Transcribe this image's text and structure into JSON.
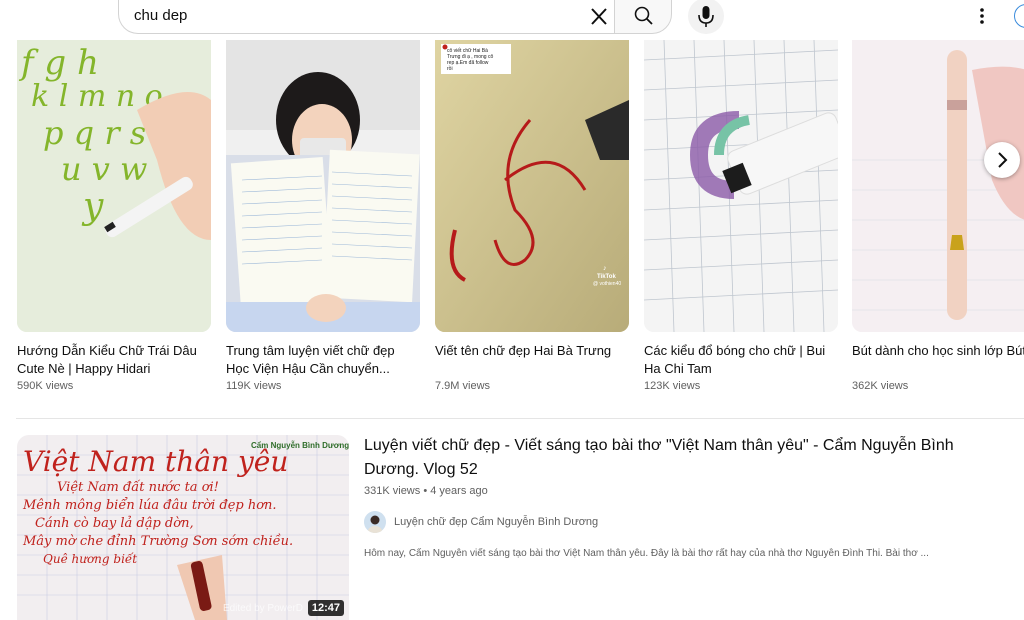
{
  "search": {
    "query": "chu dep"
  },
  "icons": {
    "clear": "close-icon",
    "search": "search-icon",
    "mic": "microphone-icon",
    "more": "more-vert-icon",
    "next": "chevron-right-icon"
  },
  "shorts": [
    {
      "title": "Hướng Dẫn Kiểu Chữ Trái Dâu Cute Nè | Happy Hidari",
      "views": "590K views"
    },
    {
      "title": "Trung tâm luyện viết chữ đẹp Học Viện Hậu Cần chuyển...",
      "views": "119K views"
    },
    {
      "title": "Viết tên chữ đẹp Hai Bà Trưng",
      "views": "7.9M views"
    },
    {
      "title": "Các kiểu đổ bóng cho chữ | Bui Ha Chi Tam",
      "views": "123K views"
    },
    {
      "title": "Bút dành cho học sinh lớp Bút luyện chữ đẹp | Bút mà",
      "views": "362K views"
    }
  ],
  "thumb_text": {
    "short1_letters": "fgh klmno pqrst uvw y",
    "short3_caption": "cô viết chữ Hai Bà Trưng đi ạ , mong cô rep ạ.Em đã follow rồi",
    "short3_tiktok": "TikTok",
    "short3_user": "@ vothien40",
    "video_line1": "Việt Nam thân yêu",
    "video_credit": "Cẩm Nguyễn Bình Dương",
    "video_line2": "Việt Nam đất nước ta ơi!",
    "video_line3": "Mênh mông biển lúa đâu trời đẹp hơn.",
    "video_line4": "Cánh cò bay lả dập dờn,",
    "video_line5": "Mây mờ che đỉnh Trường Sơn sớm chiều.",
    "video_line6": "Quê hương biết",
    "watermark": "Edited by PowerD"
  },
  "video": {
    "title": "Luyện viết chữ đẹp - Viết sáng tạo bài thơ \"Việt Nam thân yêu\" - Cẩm Nguyễn Bình Dương. Vlog 52",
    "views": "331K views",
    "age": "4 years ago",
    "channel": "Luyện chữ đẹp Cẩm Nguyễn Bình Dương",
    "description": "Hôm nay, Cẩm Nguyễn viết sáng tạo bài thơ Việt Nam thân yêu. Đây là bài thơ rất hay của nhà thơ Nguyễn Đình Thi. Bài thơ ...",
    "duration": "12:47"
  },
  "colors": {
    "accent": "#065fd4",
    "calligraphy_red": "#c0221d",
    "secondary_text": "#606060"
  }
}
